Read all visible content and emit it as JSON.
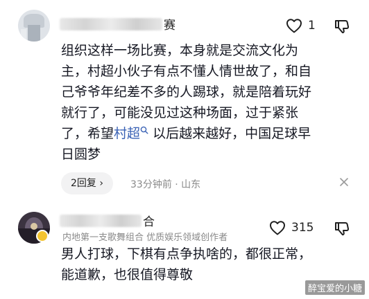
{
  "comments": [
    {
      "username_tail": "赛",
      "likes": "1",
      "text_lines": [
        "组织这样一场比赛，本身就是交流文化为",
        "主，村超小伙子有点不懂人情世故了，和自",
        "己爷爷年纪差不多的人踢球，就是陪着玩好",
        "就行了，可能没见过这种场面，过于紧张"
      ],
      "line5_before": "了，希望",
      "line5_link": "村超",
      "line5_after": " 以后越来越好，中国足球早",
      "line6": "日圆梦",
      "reply_label": "2回复 ›",
      "meta": "33分钟前 · 山东"
    },
    {
      "username_tail": "合",
      "meta": "内地第一支歌舞组合  优质娱乐领域创作者",
      "likes": "315",
      "text_lines": [
        "男人打球，下棋有点争执啥的，都很正常，",
        "能道歉，也很值得尊敬"
      ]
    }
  ],
  "icons": {
    "like": "heart-outline-icon",
    "dislike": "thumbs-down-icon",
    "close": "close-icon",
    "search_link": "search-icon"
  },
  "colors": {
    "link": "#3a62b5",
    "meta": "#8a8a8a",
    "text": "#161823"
  },
  "watermark": "醉宝爱的小糖"
}
